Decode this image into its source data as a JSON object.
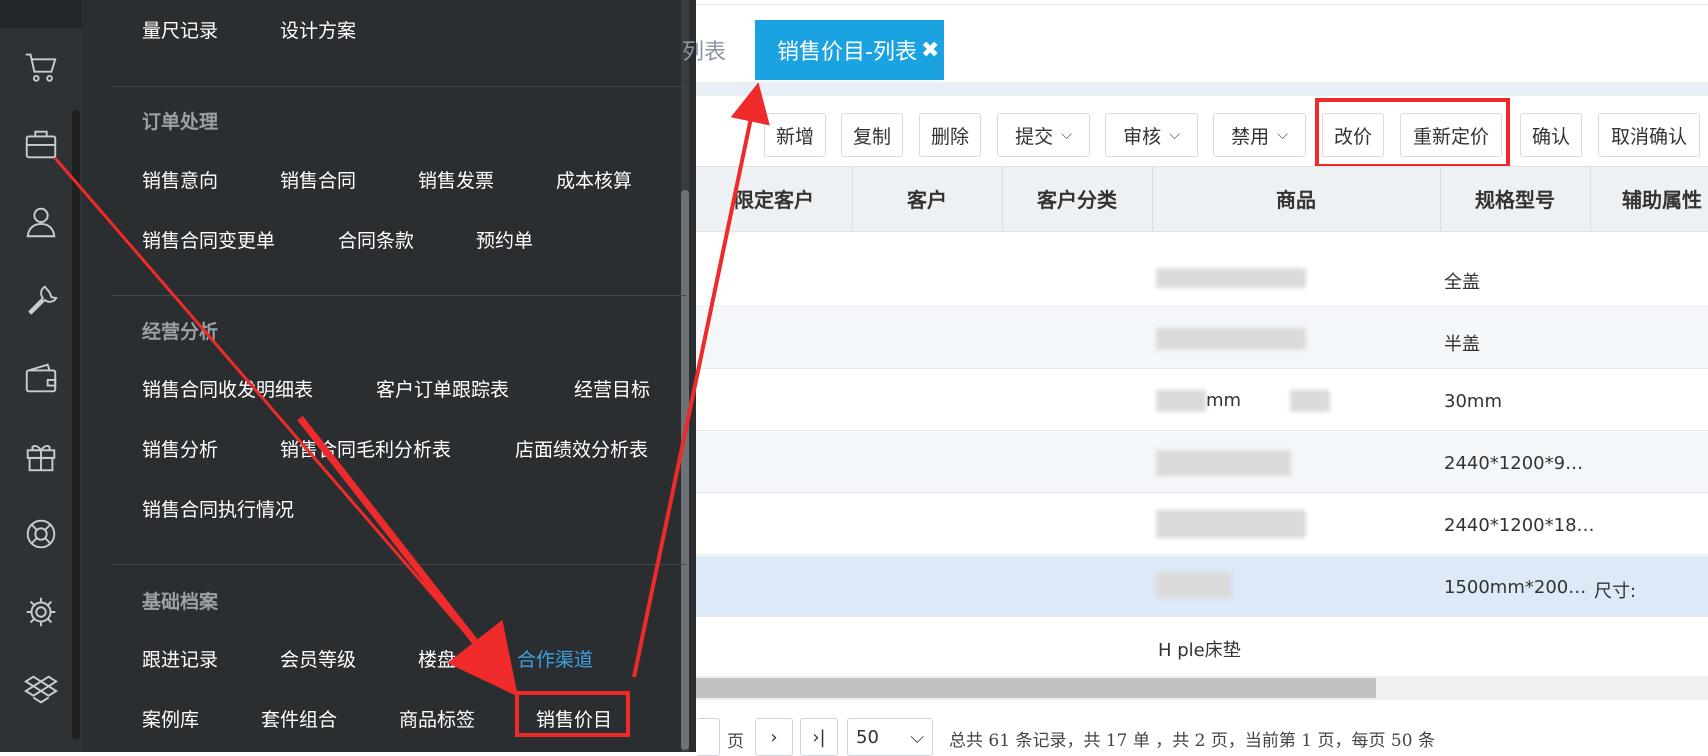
{
  "colors": {
    "accent": "#1aa3e0",
    "highlight": "#ee2a2a",
    "menu_bg": "#2b2e31",
    "active_menu": "#3fa0e0"
  },
  "rail": {
    "icons": [
      "cart-icon",
      "briefcase-icon",
      "user-icon",
      "wrench-icon",
      "wallet-icon",
      "gift-icon",
      "lifebuoy-icon",
      "gear-icon",
      "dropbox-icon"
    ]
  },
  "menu": {
    "top_items": [
      "量尺记录",
      "设计方案"
    ],
    "sections": [
      {
        "title": "订单处理",
        "rows": [
          [
            "销售意向",
            "销售合同",
            "销售发票",
            "成本核算"
          ],
          [
            "销售合同变更单",
            "合同条款",
            "预约单"
          ]
        ]
      },
      {
        "title": "经营分析",
        "rows": [
          [
            "销售合同收发明细表",
            "客户订单跟踪表",
            "经营目标"
          ],
          [
            "销售分析",
            "销售合同毛利分析表",
            "店面绩效分析表"
          ],
          [
            "销售合同执行情况"
          ]
        ]
      },
      {
        "title": "基础档案",
        "rows": [
          [
            "跟进记录",
            "会员等级",
            "楼盘",
            "合作渠道"
          ],
          [
            "案例库",
            "套件组合",
            "商品标签",
            "销售价目"
          ]
        ]
      }
    ]
  },
  "tabs": {
    "prev_tab": "列表",
    "active_tab": "销售价目-列表",
    "close": "✖"
  },
  "toolbar": {
    "buttons": [
      "新增",
      "复制",
      "删除",
      "提交",
      "审核",
      "禁用",
      "改价",
      "重新定价",
      "确认",
      "取消确认"
    ]
  },
  "table": {
    "headers": [
      "限定客户",
      "客户",
      "客户分类",
      "商品",
      "规格型号",
      "辅助属性"
    ],
    "rows": [
      {
        "product": "",
        "spec": "全盖",
        "aux": ""
      },
      {
        "product": "",
        "spec": "半盖",
        "aux": ""
      },
      {
        "product": "mm",
        "spec": "30mm",
        "aux": ""
      },
      {
        "product": "",
        "spec": "2440*1200*9…",
        "aux": ""
      },
      {
        "product": "",
        "spec": "2440*1200*18…",
        "aux": ""
      },
      {
        "product": "",
        "spec": "1500mm*200…",
        "aux": "尺寸:"
      },
      {
        "product": "H   ple床垫",
        "spec": "",
        "aux": ""
      }
    ]
  },
  "pager": {
    "page_label": "页",
    "next": "›",
    "last": "›|",
    "page_size": "50",
    "summary": "总共 61 条记录，共 17 单 ，共 2 页，当前第 1 页，每页 50 条"
  }
}
